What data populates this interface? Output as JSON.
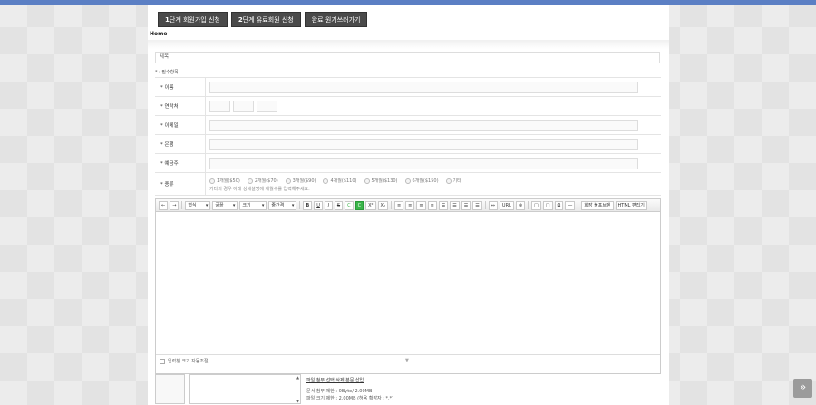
{
  "steps": [
    {
      "num": "1",
      "label": "단계 회원가입 신청"
    },
    {
      "num": "2",
      "label": "단계 유료회원 신청"
    },
    {
      "num": "",
      "label": "완료 원기쓰러가기"
    }
  ],
  "breadcrumb": "Home",
  "subject_label": "제목",
  "required_note": "* : 필수항목",
  "form": {
    "name_label": "* 이름",
    "phone_label": "* 연락처",
    "email_label": "* 이메일",
    "bank_label": "* 은행",
    "depositor_label": "* 예금주",
    "kind_label": "* 종류",
    "kind_options": [
      "1개월($50)",
      "2개월($70)",
      "3개월($90)",
      "4개월($110)",
      "5개월($130)",
      "6개월($150)",
      "기타"
    ],
    "kind_note": "기타의 경우 아래 상세설명에 개월수를 입력해주세요."
  },
  "editor": {
    "toolbar": {
      "undo": "←",
      "redo": "→",
      "format": "형식",
      "font": "굴꼴",
      "size": "크기",
      "line_height": "줄간격",
      "bold": "B",
      "underline": "U",
      "italic": "I",
      "strike": "S",
      "color": "C",
      "bgcolor": "C",
      "sup": "X²",
      "sub": "X₂",
      "align": [
        "≡",
        "≡",
        "≡",
        "≡"
      ],
      "list": [
        "☰",
        "☰",
        "☰",
        "☰"
      ],
      "link": "⇔",
      "url": "URL",
      "unlink": "⊗",
      "boxes": [
        "□",
        "□",
        "Ω",
        "—"
      ],
      "import": "화장 불포브렌",
      "html": "HTML 편집기"
    },
    "autoresize": "입력창 크기 자동조절",
    "grip": "▼"
  },
  "upload": {
    "scroll_up": "▲",
    "scroll_down": "▼",
    "action": "파일 첨부 선택 삭제 본문 삽입",
    "doc_limit": "문서 첨부 제한 : 0Byte/ 2.00MB",
    "file_limit": "파일 크기 제한 : 2.00MB (허용 확장자 : *.*)"
  },
  "top_button": "»",
  "colors": {
    "topbar": "#5b7fc4",
    "step_button": "#4a4a4a",
    "green": "#3ab54a"
  }
}
